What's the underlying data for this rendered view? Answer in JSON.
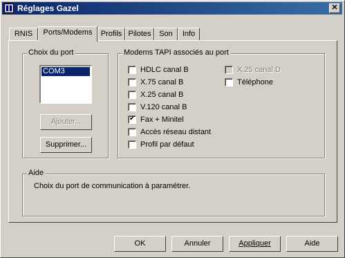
{
  "window": {
    "title": "Réglages Gazel"
  },
  "tabs": [
    {
      "label": "RNIS"
    },
    {
      "label": "Ports/Modems",
      "active": true
    },
    {
      "label": "Profils"
    },
    {
      "label": "Pilotes"
    },
    {
      "label": "Son"
    },
    {
      "label": "Info"
    }
  ],
  "port_group": {
    "title": "Choix du port",
    "list": [
      "COM3"
    ],
    "selected": "COM3",
    "add_label": "Ajouter...",
    "remove_label": "Supprimer..."
  },
  "tapi_group": {
    "title": "Modems TAPI associés au port",
    "checkboxes": [
      {
        "label": "HDLC canal B",
        "checked": false,
        "enabled": true
      },
      {
        "label": "X.75 canal B",
        "checked": false,
        "enabled": true
      },
      {
        "label": "X.25 canal B",
        "checked": false,
        "enabled": true
      },
      {
        "label": "V.120 canal B",
        "checked": false,
        "enabled": true
      },
      {
        "label": "Fax + Minitel",
        "checked": true,
        "enabled": true
      },
      {
        "label": "Accès réseau distant",
        "checked": false,
        "enabled": true
      },
      {
        "label": "Profil par défaut",
        "checked": false,
        "enabled": true
      },
      {
        "label": "X.25 canal D",
        "checked": false,
        "enabled": false
      },
      {
        "label": "Téléphone",
        "checked": false,
        "enabled": true
      }
    ]
  },
  "help_group": {
    "title": "Aide",
    "text": "Choix du port de communication à paramétrer."
  },
  "buttons": {
    "ok": "OK",
    "cancel": "Annuler",
    "apply": "Appliquer",
    "help": "Aide"
  }
}
